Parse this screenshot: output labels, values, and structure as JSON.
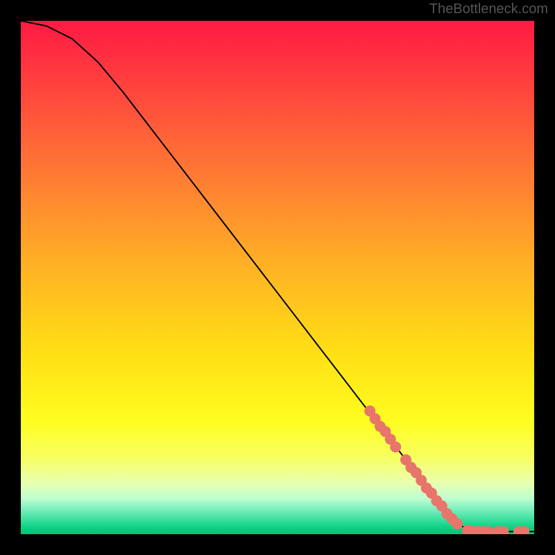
{
  "watermark": "TheBottleneck.com",
  "chart_data": {
    "type": "line",
    "title": "",
    "xlabel": "",
    "ylabel": "",
    "xlim": [
      0,
      100
    ],
    "ylim": [
      0,
      100
    ],
    "curve": {
      "name": "bottleneck-curve",
      "points": [
        {
          "x": 0,
          "y": 100
        },
        {
          "x": 5,
          "y": 99
        },
        {
          "x": 10,
          "y": 96.5
        },
        {
          "x": 15,
          "y": 92
        },
        {
          "x": 20,
          "y": 86
        },
        {
          "x": 30,
          "y": 73
        },
        {
          "x": 40,
          "y": 60
        },
        {
          "x": 50,
          "y": 47
        },
        {
          "x": 60,
          "y": 34
        },
        {
          "x": 70,
          "y": 21
        },
        {
          "x": 80,
          "y": 8
        },
        {
          "x": 85,
          "y": 2
        },
        {
          "x": 88,
          "y": 0.5
        },
        {
          "x": 100,
          "y": 0.5
        }
      ]
    },
    "markers": {
      "name": "highlighted-points",
      "color": "#e8756b",
      "points": [
        {
          "x": 68,
          "y": 24
        },
        {
          "x": 69,
          "y": 22.5
        },
        {
          "x": 70,
          "y": 21
        },
        {
          "x": 71,
          "y": 20
        },
        {
          "x": 72,
          "y": 18.5
        },
        {
          "x": 73,
          "y": 17
        },
        {
          "x": 75,
          "y": 14.5
        },
        {
          "x": 76,
          "y": 13
        },
        {
          "x": 77,
          "y": 12
        },
        {
          "x": 78,
          "y": 10.5
        },
        {
          "x": 79,
          "y": 9
        },
        {
          "x": 80,
          "y": 8
        },
        {
          "x": 81,
          "y": 6.5
        },
        {
          "x": 82,
          "y": 5.5
        },
        {
          "x": 83,
          "y": 4
        },
        {
          "x": 84,
          "y": 3
        },
        {
          "x": 85,
          "y": 2
        },
        {
          "x": 87,
          "y": 0.7
        },
        {
          "x": 88,
          "y": 0.5
        },
        {
          "x": 89,
          "y": 0.5
        },
        {
          "x": 90,
          "y": 0.5
        },
        {
          "x": 91,
          "y": 0.5
        },
        {
          "x": 93,
          "y": 0.5
        },
        {
          "x": 94,
          "y": 0.5
        },
        {
          "x": 97,
          "y": 0.5
        },
        {
          "x": 98,
          "y": 0.5
        }
      ]
    }
  }
}
